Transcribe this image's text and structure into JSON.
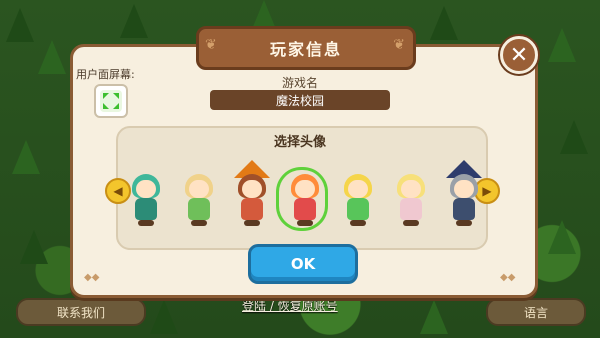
{
  "dialog": {
    "title": "玩家信息",
    "close_symbol": "✕",
    "screen_label": "用户面屏幕:",
    "name_label": "游戏名",
    "name_value": "魔法校园",
    "avatar_section_title": "选择头像",
    "ok_label": "OK"
  },
  "avatars": [
    {
      "hair": "#3fb79a",
      "body": "#2c8c77",
      "selected": false,
      "hat": false
    },
    {
      "hair": "#f0d28a",
      "body": "#6fbf5a",
      "selected": false,
      "hat": false
    },
    {
      "hair": "#a0502a",
      "body": "#d45a3c",
      "selected": false,
      "hat": true,
      "hat_color": "#e27a16"
    },
    {
      "hair": "#ff8c3a",
      "body": "#e24b4b",
      "selected": true,
      "hat": false
    },
    {
      "hair": "#f5d54a",
      "body": "#58c55a",
      "selected": false,
      "hat": false
    },
    {
      "hair": "#f7e07a",
      "body": "#f0c8d0",
      "selected": false,
      "hat": false
    },
    {
      "hair": "#9aa0a8",
      "body": "#3d4e6e",
      "selected": false,
      "hat": true,
      "hat_color": "#2e3c6c"
    }
  ],
  "bottom_bar": {
    "contact_label": "联系我们",
    "login_label": "登陆 / 恢复原账号",
    "language_label": "语言"
  },
  "icons": {
    "close": "close-icon",
    "fullscreen": "fullscreen-icon",
    "prev": "chevron-left-icon",
    "next": "chevron-right-icon"
  },
  "colors": {
    "title_plate": "#9a5f36",
    "dialog_bg": "#f7efdf",
    "ok_button": "#2fa8e6",
    "arrow_button": "#f3c52c",
    "selected_outline": "#5fd13b"
  }
}
